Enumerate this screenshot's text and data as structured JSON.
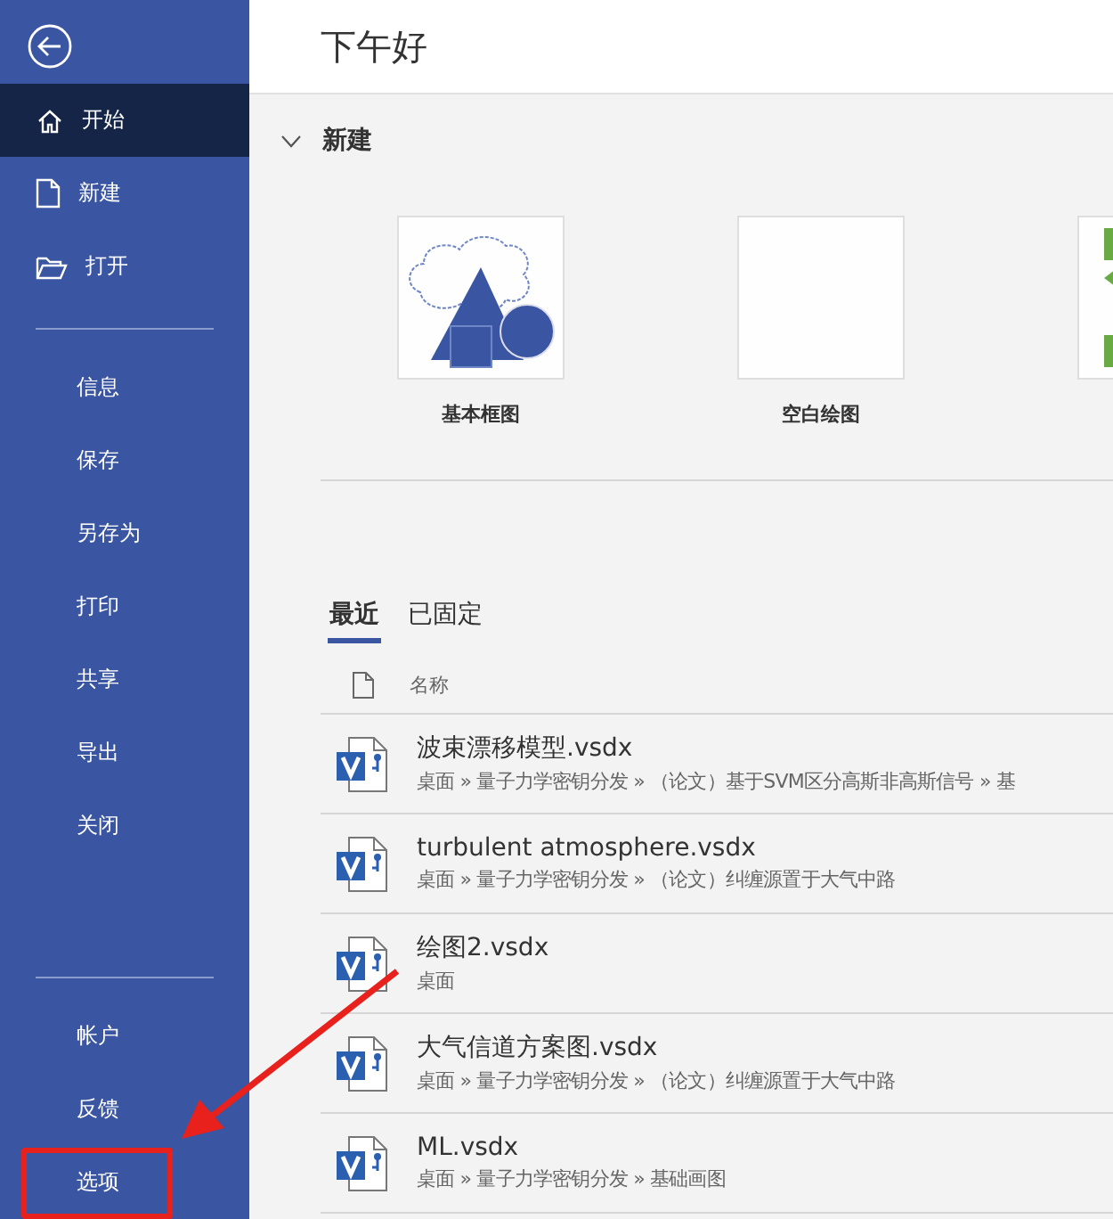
{
  "sidebar": {
    "top_items": [
      {
        "label": "开始",
        "selected": true
      },
      {
        "label": "新建",
        "selected": false
      },
      {
        "label": "打开",
        "selected": false
      }
    ],
    "middle_items": [
      {
        "label": "信息",
        "selected": false
      },
      {
        "label": "保存",
        "selected": false
      },
      {
        "label": "另存为",
        "selected": false
      },
      {
        "label": "打印",
        "selected": false
      },
      {
        "label": "共享",
        "selected": false
      },
      {
        "label": "导出",
        "selected": false
      },
      {
        "label": "关闭",
        "selected": false
      }
    ],
    "bottom_items": [
      {
        "label": "帐户",
        "selected": false,
        "callout": false
      },
      {
        "label": "反馈",
        "selected": false,
        "callout": false
      },
      {
        "label": "选项",
        "selected": false,
        "callout": true
      }
    ]
  },
  "greeting": "下午好",
  "new_section": {
    "title": "新建",
    "expanded": true,
    "templates": [
      {
        "kind": "basic",
        "label": "基本框图"
      },
      {
        "kind": "blank",
        "label": "空白绘图"
      },
      {
        "kind": "flow"
      }
    ]
  },
  "recent": {
    "tabs": [
      {
        "label": "最近",
        "selected": true
      },
      {
        "label": "已固定",
        "selected": false
      }
    ],
    "column": "名称",
    "files": [
      {
        "name": "波束漂移模型.vsdx",
        "path": "桌面 » 量子力学密钥分发 » （论文）基于SVM区分高斯非高斯信号 » 基"
      },
      {
        "name": "turbulent atmosphere.vsdx",
        "path": "桌面 » 量子力学密钥分发 » （论文）纠缠源置于大气中路"
      },
      {
        "name": "绘图2.vsdx",
        "path": "桌面"
      },
      {
        "name": "大气信道方案图.vsdx",
        "path": "桌面 » 量子力学密钥分发 » （论文）纠缠源置于大气中路"
      },
      {
        "name": "ML.vsdx",
        "path": "桌面 » 量子力学密钥分发 » 基础画图"
      }
    ]
  }
}
